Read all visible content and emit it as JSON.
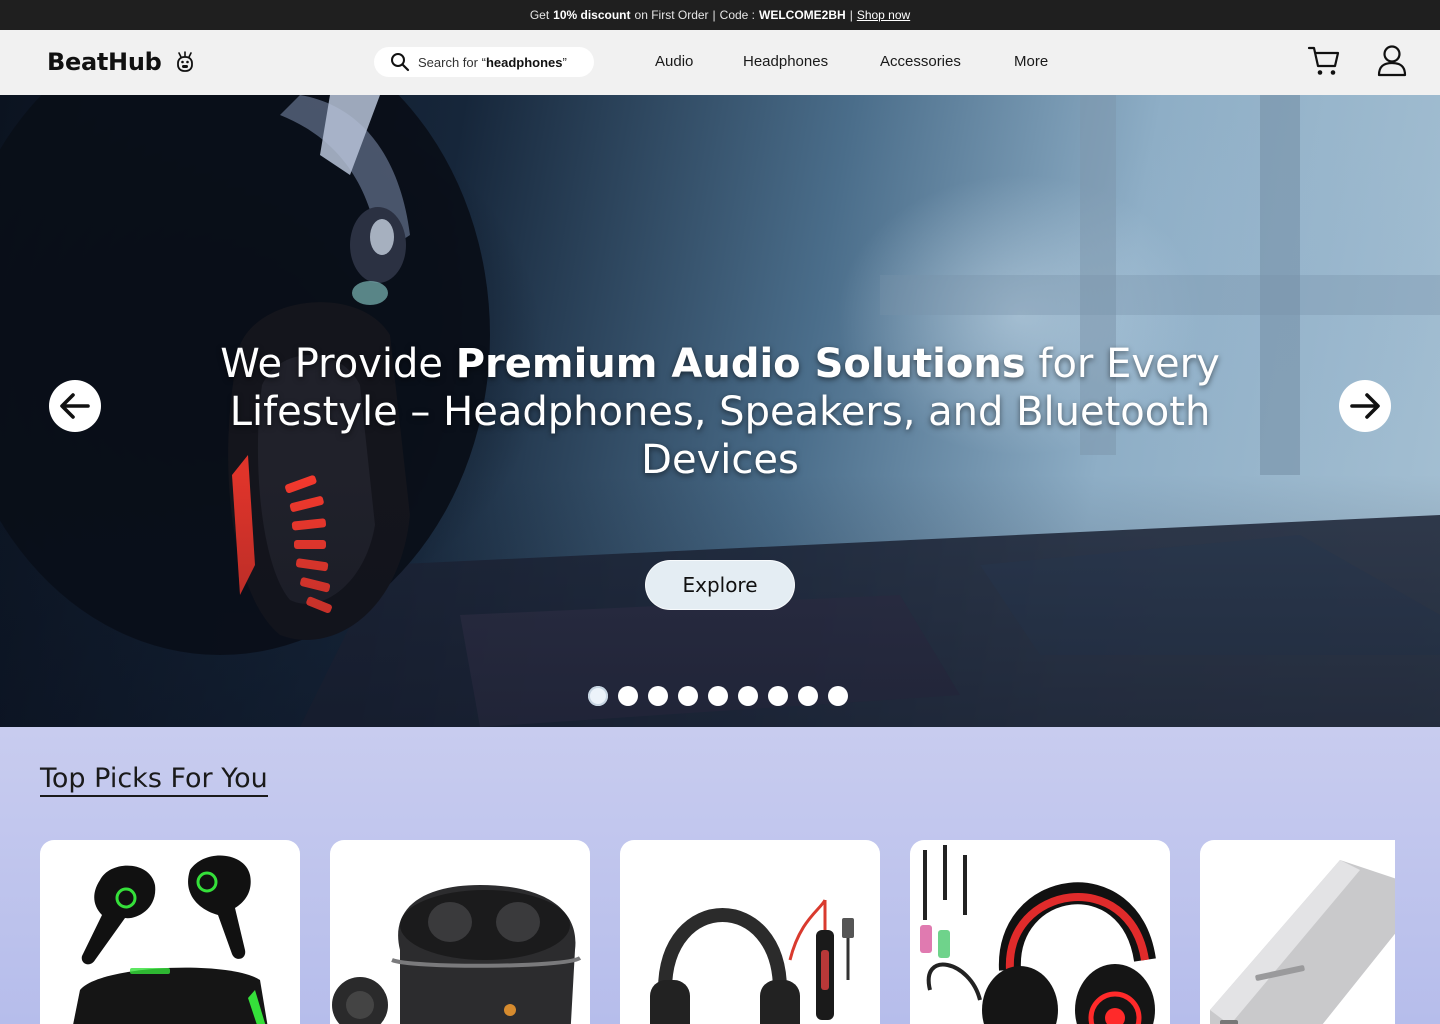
{
  "announcement": {
    "prefix": "Get",
    "discount": "10% discount",
    "middle": "on First Order",
    "code_label": "Code :",
    "code": "WELCOME2BH",
    "link": "Shop now"
  },
  "header": {
    "brand": "BeatHub",
    "search": {
      "prefix": "Search for ",
      "open_quote": "“",
      "query": "headphones",
      "close_quote": "”"
    },
    "nav": [
      "Audio",
      "Headphones",
      "Accessories",
      "More"
    ]
  },
  "hero": {
    "title_plain_1": "We Provide ",
    "title_bold": "Premium Audio Solutions",
    "title_plain_2": " for Every Lifestyle – Headphones, Speakers, and Bluetooth Devices",
    "cta": "Explore",
    "slide_count": 9,
    "active_slide": 1
  },
  "top_picks": {
    "title": "Top Picks For You",
    "products": [
      {
        "icon": "gaming-earbuds-icon"
      },
      {
        "icon": "wireless-earbuds-case-icon"
      },
      {
        "icon": "wired-headset-icon"
      },
      {
        "icon": "rgb-gaming-headset-icon"
      },
      {
        "icon": "power-bank-icon"
      }
    ]
  },
  "colors": {
    "announcement_bg": "#1f1f1f",
    "header_bg": "#f1f1f1",
    "section_bg": "#c4c8ee",
    "button_bg": "#e4edf3"
  }
}
